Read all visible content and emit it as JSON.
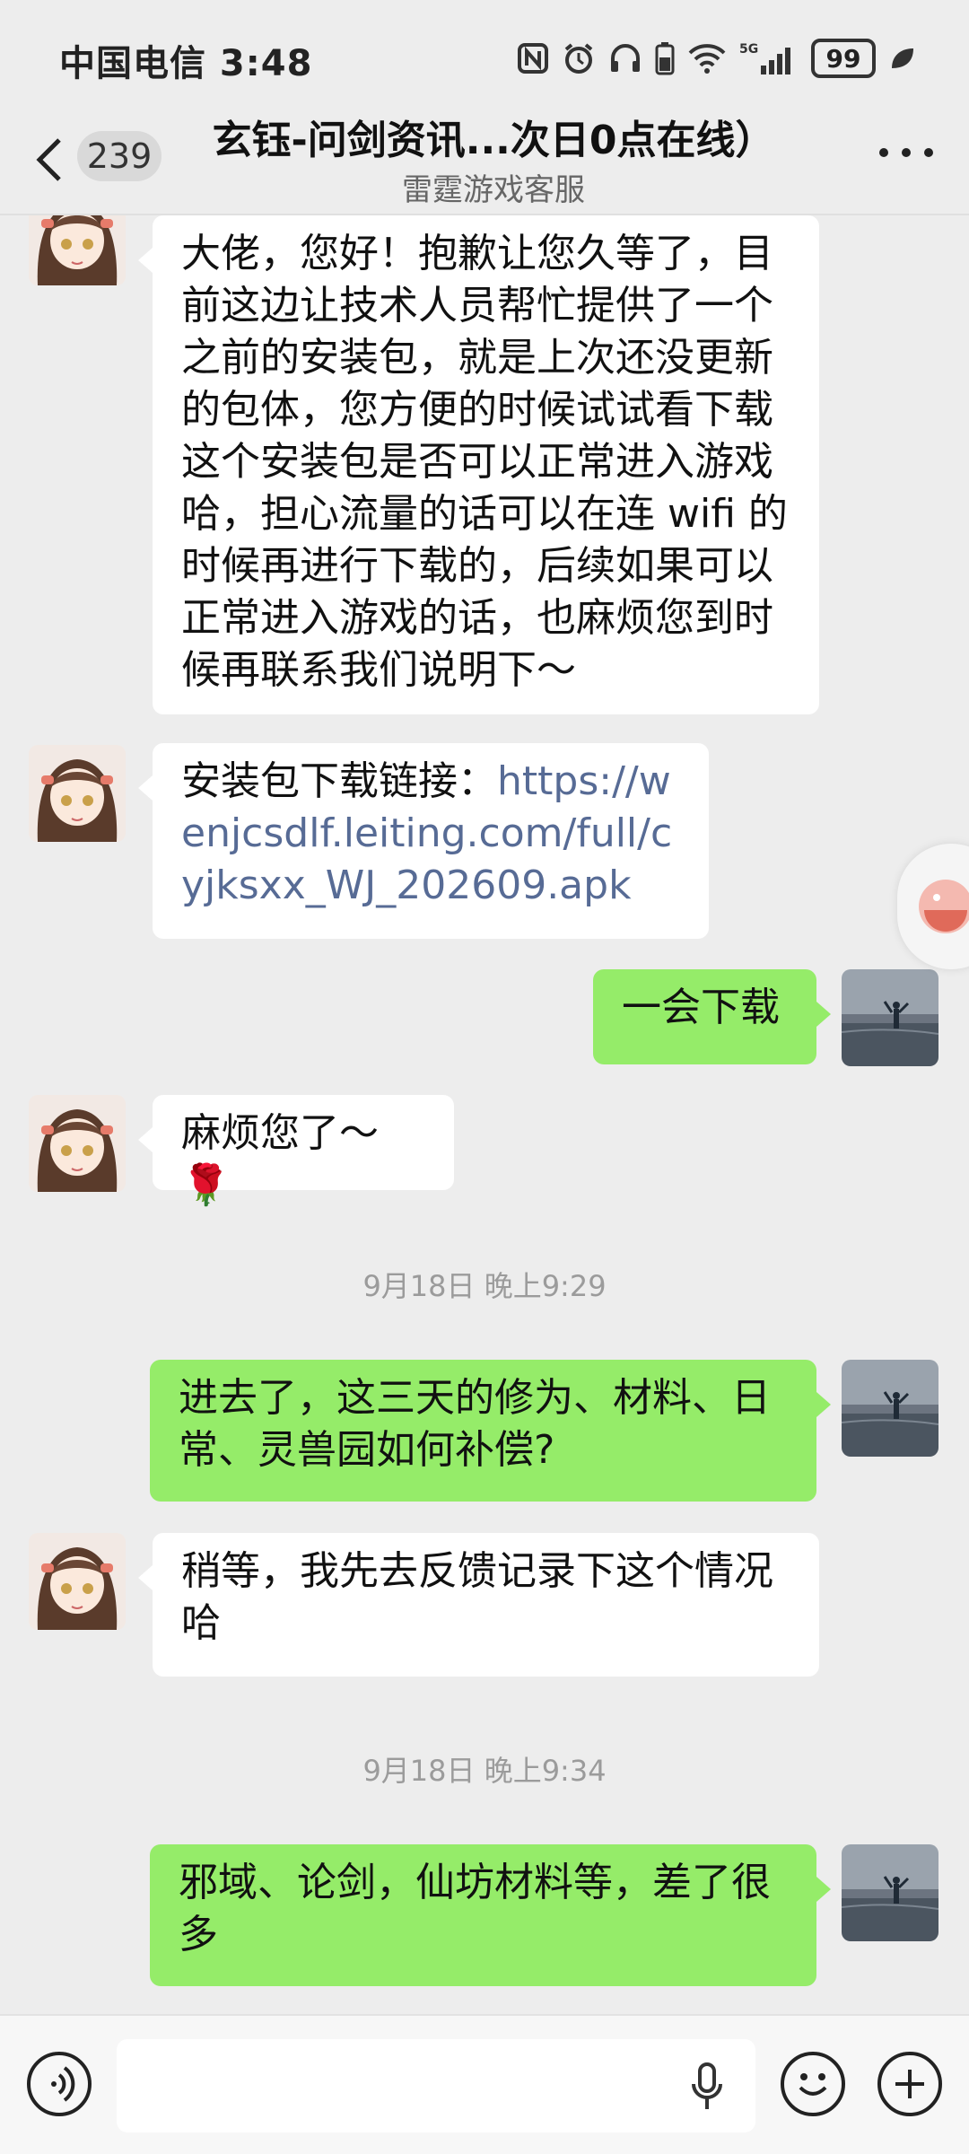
{
  "status_bar": {
    "carrier_time": "中国电信 3:48",
    "battery": "99",
    "icons": [
      "nfc-icon",
      "alarm-icon",
      "headphones-icon",
      "battery-saver-icon",
      "wifi-icon",
      "5g-signal-icon",
      "battery-icon",
      "leaf-icon"
    ]
  },
  "header": {
    "back_icon": "chevron-left-icon",
    "unread_count": "239",
    "title": "玄钰-问剑资讯...次日0点在线）",
    "subtitle": "雷霆游戏客服",
    "more_icon": "more-dots-icon"
  },
  "messages": [
    {
      "side": "left",
      "text": "大佬，您好！抱歉让您久等了，目前这边让技术人员帮忙提供了一个之前的安装包，就是上次还没更新的包体，您方便的时候试试看下载这个安装包是否可以正常进入游戏哈，担心流量的话可以在连 wifi 的时候再进行下载的，后续如果可以正常进入游戏的话，也麻烦您到时候再联系我们说明下～"
    },
    {
      "side": "left",
      "prefix": "安装包下载链接：",
      "link": "https://wenjcsdlf.leiting.com/full/cyjksxx_WJ_202609.apk"
    },
    {
      "side": "right",
      "text": "一会下载"
    },
    {
      "side": "left",
      "text": "麻烦您了～🌹"
    },
    {
      "side": "right",
      "text": "进去了，这三天的修为、材料、日常、灵兽园如何补偿?"
    },
    {
      "side": "left",
      "text": "稍等，我先去反馈记录下这个情况哈"
    },
    {
      "side": "right",
      "text": "邪域、论剑，仙坊材料等，差了很多"
    }
  ],
  "timestamps": [
    "9月18日 晚上9:29",
    "9月18日 晚上9:34"
  ],
  "input_bar": {
    "voice_icon": "voice-icon",
    "mic_icon": "mic-icon",
    "emoji_icon": "emoji-icon",
    "plus_icon": "plus-icon"
  }
}
